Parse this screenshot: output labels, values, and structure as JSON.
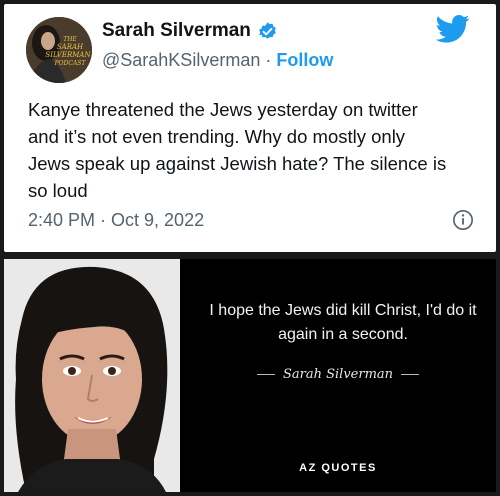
{
  "tweet": {
    "display_name": "Sarah Silverman",
    "handle": "@SarahKSilverman",
    "separator": "·",
    "follow_label": "Follow",
    "avatar_text": "THE SARAH SILVERMAN PODCAST",
    "body": "Kanye threatened the Jews yesterday on twitter\nand it’s not even trending.  Why do mostly only\nJews speak up against Jewish hate? The silence is\nso loud",
    "timestamp": "2:40 PM · Oct 9, 2022",
    "icons": {
      "verified": "verified-badge-icon",
      "brand": "twitter-bird-icon",
      "info": "info-icon"
    },
    "colors": {
      "accent": "#1d9bf0",
      "text": "#0f1419",
      "muted": "#536471"
    }
  },
  "quote_image": {
    "quote": "I hope the Jews did kill Christ, I'd do it again in a second.",
    "attribution": "Sarah Silverman",
    "brand": "AZ QUOTES"
  }
}
